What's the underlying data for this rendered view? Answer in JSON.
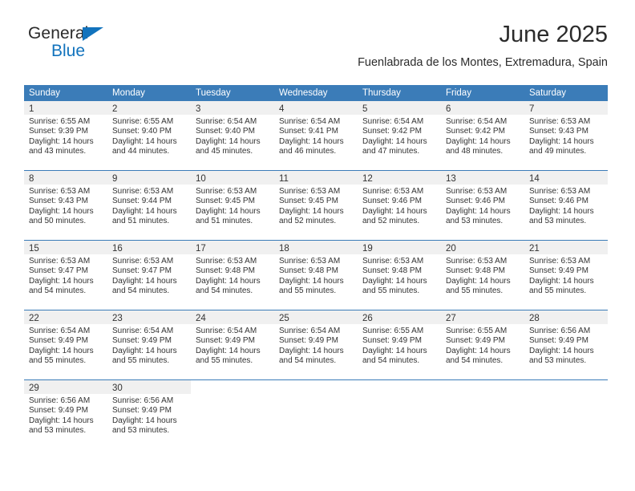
{
  "brand": {
    "line1": "General",
    "line2": "Blue",
    "triangle_color": "#1273bd"
  },
  "header": {
    "month_title": "June 2025",
    "location": "Fuenlabrada de los Montes, Extremadura, Spain"
  },
  "theme": {
    "header_blue": "#3b7cb8",
    "daynum_band": "#f0f0f0",
    "text": "#333333"
  },
  "weekdays": [
    "Sunday",
    "Monday",
    "Tuesday",
    "Wednesday",
    "Thursday",
    "Friday",
    "Saturday"
  ],
  "weeks": [
    [
      {
        "day": "1",
        "sunrise": "Sunrise: 6:55 AM",
        "sunset": "Sunset: 9:39 PM",
        "daylight": "Daylight: 14 hours and 43 minutes."
      },
      {
        "day": "2",
        "sunrise": "Sunrise: 6:55 AM",
        "sunset": "Sunset: 9:40 PM",
        "daylight": "Daylight: 14 hours and 44 minutes."
      },
      {
        "day": "3",
        "sunrise": "Sunrise: 6:54 AM",
        "sunset": "Sunset: 9:40 PM",
        "daylight": "Daylight: 14 hours and 45 minutes."
      },
      {
        "day": "4",
        "sunrise": "Sunrise: 6:54 AM",
        "sunset": "Sunset: 9:41 PM",
        "daylight": "Daylight: 14 hours and 46 minutes."
      },
      {
        "day": "5",
        "sunrise": "Sunrise: 6:54 AM",
        "sunset": "Sunset: 9:42 PM",
        "daylight": "Daylight: 14 hours and 47 minutes."
      },
      {
        "day": "6",
        "sunrise": "Sunrise: 6:54 AM",
        "sunset": "Sunset: 9:42 PM",
        "daylight": "Daylight: 14 hours and 48 minutes."
      },
      {
        "day": "7",
        "sunrise": "Sunrise: 6:53 AM",
        "sunset": "Sunset: 9:43 PM",
        "daylight": "Daylight: 14 hours and 49 minutes."
      }
    ],
    [
      {
        "day": "8",
        "sunrise": "Sunrise: 6:53 AM",
        "sunset": "Sunset: 9:43 PM",
        "daylight": "Daylight: 14 hours and 50 minutes."
      },
      {
        "day": "9",
        "sunrise": "Sunrise: 6:53 AM",
        "sunset": "Sunset: 9:44 PM",
        "daylight": "Daylight: 14 hours and 51 minutes."
      },
      {
        "day": "10",
        "sunrise": "Sunrise: 6:53 AM",
        "sunset": "Sunset: 9:45 PM",
        "daylight": "Daylight: 14 hours and 51 minutes."
      },
      {
        "day": "11",
        "sunrise": "Sunrise: 6:53 AM",
        "sunset": "Sunset: 9:45 PM",
        "daylight": "Daylight: 14 hours and 52 minutes."
      },
      {
        "day": "12",
        "sunrise": "Sunrise: 6:53 AM",
        "sunset": "Sunset: 9:46 PM",
        "daylight": "Daylight: 14 hours and 52 minutes."
      },
      {
        "day": "13",
        "sunrise": "Sunrise: 6:53 AM",
        "sunset": "Sunset: 9:46 PM",
        "daylight": "Daylight: 14 hours and 53 minutes."
      },
      {
        "day": "14",
        "sunrise": "Sunrise: 6:53 AM",
        "sunset": "Sunset: 9:46 PM",
        "daylight": "Daylight: 14 hours and 53 minutes."
      }
    ],
    [
      {
        "day": "15",
        "sunrise": "Sunrise: 6:53 AM",
        "sunset": "Sunset: 9:47 PM",
        "daylight": "Daylight: 14 hours and 54 minutes."
      },
      {
        "day": "16",
        "sunrise": "Sunrise: 6:53 AM",
        "sunset": "Sunset: 9:47 PM",
        "daylight": "Daylight: 14 hours and 54 minutes."
      },
      {
        "day": "17",
        "sunrise": "Sunrise: 6:53 AM",
        "sunset": "Sunset: 9:48 PM",
        "daylight": "Daylight: 14 hours and 54 minutes."
      },
      {
        "day": "18",
        "sunrise": "Sunrise: 6:53 AM",
        "sunset": "Sunset: 9:48 PM",
        "daylight": "Daylight: 14 hours and 55 minutes."
      },
      {
        "day": "19",
        "sunrise": "Sunrise: 6:53 AM",
        "sunset": "Sunset: 9:48 PM",
        "daylight": "Daylight: 14 hours and 55 minutes."
      },
      {
        "day": "20",
        "sunrise": "Sunrise: 6:53 AM",
        "sunset": "Sunset: 9:48 PM",
        "daylight": "Daylight: 14 hours and 55 minutes."
      },
      {
        "day": "21",
        "sunrise": "Sunrise: 6:53 AM",
        "sunset": "Sunset: 9:49 PM",
        "daylight": "Daylight: 14 hours and 55 minutes."
      }
    ],
    [
      {
        "day": "22",
        "sunrise": "Sunrise: 6:54 AM",
        "sunset": "Sunset: 9:49 PM",
        "daylight": "Daylight: 14 hours and 55 minutes."
      },
      {
        "day": "23",
        "sunrise": "Sunrise: 6:54 AM",
        "sunset": "Sunset: 9:49 PM",
        "daylight": "Daylight: 14 hours and 55 minutes."
      },
      {
        "day": "24",
        "sunrise": "Sunrise: 6:54 AM",
        "sunset": "Sunset: 9:49 PM",
        "daylight": "Daylight: 14 hours and 55 minutes."
      },
      {
        "day": "25",
        "sunrise": "Sunrise: 6:54 AM",
        "sunset": "Sunset: 9:49 PM",
        "daylight": "Daylight: 14 hours and 54 minutes."
      },
      {
        "day": "26",
        "sunrise": "Sunrise: 6:55 AM",
        "sunset": "Sunset: 9:49 PM",
        "daylight": "Daylight: 14 hours and 54 minutes."
      },
      {
        "day": "27",
        "sunrise": "Sunrise: 6:55 AM",
        "sunset": "Sunset: 9:49 PM",
        "daylight": "Daylight: 14 hours and 54 minutes."
      },
      {
        "day": "28",
        "sunrise": "Sunrise: 6:56 AM",
        "sunset": "Sunset: 9:49 PM",
        "daylight": "Daylight: 14 hours and 53 minutes."
      }
    ],
    [
      {
        "day": "29",
        "sunrise": "Sunrise: 6:56 AM",
        "sunset": "Sunset: 9:49 PM",
        "daylight": "Daylight: 14 hours and 53 minutes."
      },
      {
        "day": "30",
        "sunrise": "Sunrise: 6:56 AM",
        "sunset": "Sunset: 9:49 PM",
        "daylight": "Daylight: 14 hours and 53 minutes."
      },
      null,
      null,
      null,
      null,
      null
    ]
  ]
}
